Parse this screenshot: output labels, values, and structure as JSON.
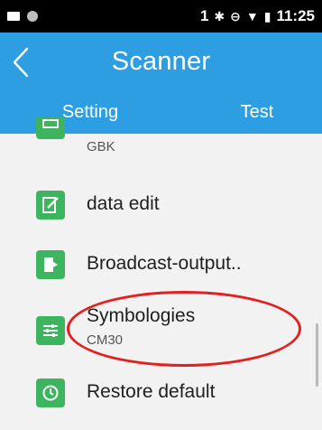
{
  "status_bar": {
    "sim_label": "1",
    "icons": [
      "bluetooth-icon",
      "minus-circle-icon",
      "wifi-icon",
      "battery-icon"
    ],
    "time": "11:25"
  },
  "app_bar": {
    "back_icon": "chevron-left-icon",
    "title": "Scanner",
    "color": "#2d9ee2"
  },
  "tabs": [
    {
      "label": "Setting",
      "selected": true
    },
    {
      "label": "Test",
      "selected": false
    }
  ],
  "list": {
    "items": [
      {
        "title": "",
        "subtitle": "GBK",
        "icon": "charset-icon"
      },
      {
        "title": "data edit",
        "subtitle": "",
        "icon": "edit-icon"
      },
      {
        "title": "Broadcast-output..",
        "subtitle": "",
        "icon": "output-icon"
      },
      {
        "title": "Symbologies",
        "subtitle": "CM30",
        "icon": "sliders-icon"
      },
      {
        "title": "Restore default",
        "subtitle": "",
        "icon": "clock-icon"
      }
    ]
  },
  "annotation": {
    "shape": "ellipse",
    "color": "#e32020",
    "target": "Symbologies"
  }
}
